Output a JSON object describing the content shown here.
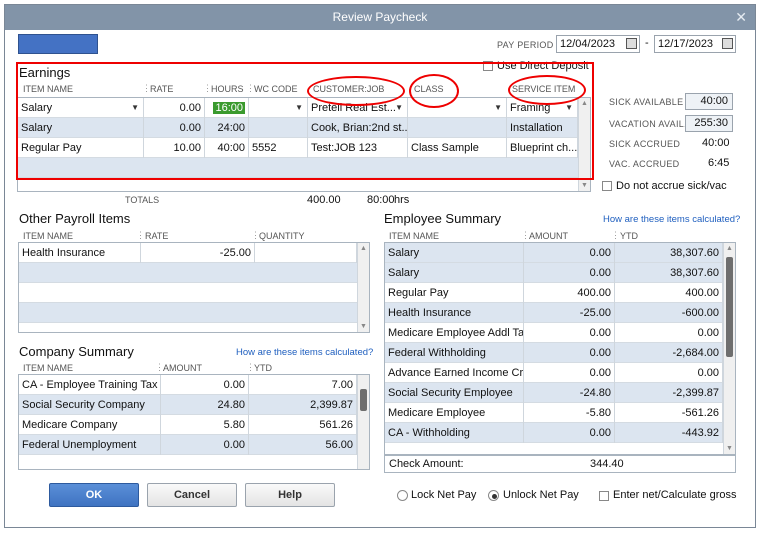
{
  "window": {
    "title": "Review Paycheck"
  },
  "pay_period": {
    "label": "PAY PERIOD",
    "from": "12/04/2023",
    "dash": "-",
    "to": "12/17/2023"
  },
  "earnings": {
    "title": "Earnings",
    "direct_deposit": "Use Direct Deposit",
    "headers": {
      "item": "ITEM NAME",
      "rate": "RATE",
      "hours": "HOURS",
      "wc": "WC CODE",
      "customer": "CUSTOMER:JOB",
      "class": "CLASS",
      "service": "SERVICE ITEM"
    },
    "rows": [
      {
        "item": "Salary",
        "rate": "0.00",
        "hours": "16:00",
        "wc": "",
        "customer": "Pretell Real Est...",
        "class": "",
        "service": "Framing"
      },
      {
        "item": "Salary",
        "rate": "0.00",
        "hours": "24:00",
        "wc": "",
        "customer": "Cook, Brian:2nd st...",
        "class": "",
        "service": "Installation"
      },
      {
        "item": "Regular Pay",
        "rate": "10.00",
        "hours": "40:00",
        "wc": "5552",
        "customer": "Test:JOB 123",
        "class": "Class Sample",
        "service": "Blueprint ch..."
      }
    ],
    "totals": {
      "label": "TOTALS",
      "amount": "400.00",
      "hours": "80:00",
      "unit": "hrs"
    }
  },
  "leave": {
    "sick_available_label": "SICK AVAILABLE",
    "sick_available": "40:00",
    "vacation_label": "VACATION AVAIL.",
    "vacation": "255:30",
    "sick_accrued_label": "SICK ACCRUED",
    "sick_accrued": "40:00",
    "vac_accrued_label": "VAC. ACCRUED",
    "vac_accrued": "6:45",
    "no_accrue": "Do not accrue sick/vac"
  },
  "other_payroll": {
    "title": "Other Payroll Items",
    "headers": {
      "item": "ITEM NAME",
      "rate": "RATE",
      "quantity": "QUANTITY"
    },
    "rows": [
      {
        "item": "Health Insurance",
        "rate": "-25.00",
        "quantity": ""
      }
    ]
  },
  "company_summary": {
    "title": "Company Summary",
    "link": "How are these items calculated?",
    "headers": {
      "item": "ITEM NAME",
      "amount": "AMOUNT",
      "ytd": "YTD"
    },
    "rows": [
      {
        "item": "CA - Employee Training Tax",
        "amount": "0.00",
        "ytd": "7.00"
      },
      {
        "item": "Social Security Company",
        "amount": "24.80",
        "ytd": "2,399.87"
      },
      {
        "item": "Medicare Company",
        "amount": "5.80",
        "ytd": "561.26"
      },
      {
        "item": "Federal Unemployment",
        "amount": "0.00",
        "ytd": "56.00"
      }
    ]
  },
  "employee_summary": {
    "title": "Employee Summary",
    "link": "How are these items calculated?",
    "headers": {
      "item": "ITEM NAME",
      "amount": "AMOUNT",
      "ytd": "YTD"
    },
    "rows": [
      {
        "item": "Salary",
        "amount": "0.00",
        "ytd": "38,307.60"
      },
      {
        "item": "Salary",
        "amount": "0.00",
        "ytd": "38,307.60"
      },
      {
        "item": "Regular Pay",
        "amount": "400.00",
        "ytd": "400.00"
      },
      {
        "item": "Health Insurance",
        "amount": "-25.00",
        "ytd": "-600.00"
      },
      {
        "item": "Medicare Employee Addl Tax",
        "amount": "0.00",
        "ytd": "0.00"
      },
      {
        "item": "Federal Withholding",
        "amount": "0.00",
        "ytd": "-2,684.00"
      },
      {
        "item": "Advance Earned Income Cr...",
        "amount": "0.00",
        "ytd": "0.00"
      },
      {
        "item": "Social Security Employee",
        "amount": "-24.80",
        "ytd": "-2,399.87"
      },
      {
        "item": "Medicare Employee",
        "amount": "-5.80",
        "ytd": "-561.26"
      },
      {
        "item": "CA - Withholding",
        "amount": "0.00",
        "ytd": "-443.92"
      }
    ],
    "check_amount_label": "Check Amount:",
    "check_amount": "344.40"
  },
  "buttons": {
    "ok": "OK",
    "cancel": "Cancel",
    "help": "Help"
  },
  "options": {
    "lock_net": "Lock Net Pay",
    "unlock_net": "Unlock Net Pay",
    "enter_net": "Enter net/Calculate gross"
  }
}
